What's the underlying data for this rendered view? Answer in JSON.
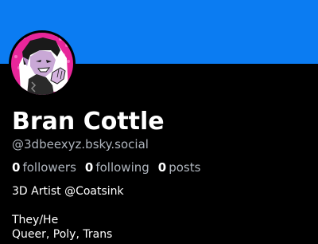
{
  "colors": {
    "banner": "#0b7cf2",
    "background": "#000000",
    "text_primary": "#ffffff",
    "text_secondary": "#aeb4bc",
    "avatar_accent": "#e8269a"
  },
  "profile": {
    "display_name": "Bran Cottle",
    "handle": "@3dbeexyz.bsky.social",
    "avatar_icon": "avatar-illustration-icon"
  },
  "stats": {
    "followers": {
      "count": "0",
      "label": "followers"
    },
    "following": {
      "count": "0",
      "label": "following"
    },
    "posts": {
      "count": "0",
      "label": "posts"
    }
  },
  "bio": {
    "line1": "3D Artist @Coatsink",
    "line2": "",
    "line3": "They/He",
    "line4": "Queer, Poly, Trans"
  }
}
